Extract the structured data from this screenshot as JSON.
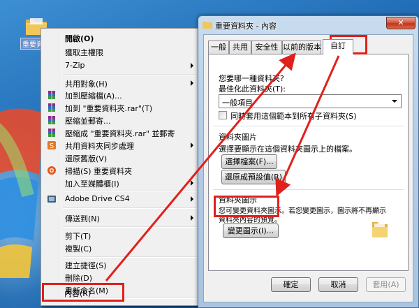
{
  "desktop": {
    "folder_label": "重要資料"
  },
  "context_menu": {
    "items": [
      {
        "label": "開啟(O)",
        "bold": true
      },
      {
        "label": "獲取主權限"
      },
      {
        "label": "7-Zip",
        "submenu": true
      },
      {
        "label": "共用對象(H)",
        "submenu": true
      },
      {
        "label": "加到壓縮檔(A)...",
        "icon": "winrar-icon"
      },
      {
        "label": "加到 \"重要資料夾.rar\"(T)",
        "icon": "winrar-icon"
      },
      {
        "label": "壓縮並郵寄...",
        "icon": "winrar-icon"
      },
      {
        "label": "壓縮成 \"重要資料夾.rar\" 並郵寄",
        "icon": "winrar-icon"
      },
      {
        "label": "共用資料夾同步處理",
        "submenu": true,
        "icon": "sync-icon"
      },
      {
        "label": "還原舊版(V)"
      },
      {
        "label": "掃描(S) 重要資料夾",
        "icon": "antivirus-icon"
      },
      {
        "label": "加入至媒體櫃(I)",
        "submenu": true
      },
      {
        "label": "Adobe Drive CS4",
        "submenu": true,
        "icon": "adobe-drive-icon"
      },
      {
        "label": "傳送到(N)",
        "submenu": true
      },
      {
        "label": "剪下(T)"
      },
      {
        "label": "複製(C)"
      },
      {
        "label": "建立捷徑(S)"
      },
      {
        "label": "刪除(D)"
      },
      {
        "label": "重新命名(M)"
      },
      {
        "label": "內容(R)"
      }
    ]
  },
  "dialog": {
    "title": "重要資料夾 - 內容",
    "close_label": "✕",
    "tabs": [
      "一般",
      "共用",
      "安全性",
      "以前的版本",
      "自訂"
    ],
    "active_tab": "自訂",
    "section1": {
      "heading": "您要哪一種資料夾?",
      "optimize_label": "最佳化此資料夾(T):",
      "select_value": "一般項目",
      "checkbox_label": "同時套用這個範本到所有子資料夾(S)"
    },
    "section2": {
      "heading": "資料夾圖片",
      "desc": "選擇要顯示在這個資料夾圖示上的檔案。",
      "choose_button": "選擇檔案(F)...",
      "restore_button": "還原成預設值(R)"
    },
    "section3": {
      "heading": "資料夾圖示",
      "desc_line1": "您可變更資料夾圖示。若您變更圖示，圖示將不再顯示",
      "desc_line2": "資料夾內容的預覽。",
      "change_button": "變更圖示(I)..."
    },
    "footer": {
      "ok": "確定",
      "cancel": "取消",
      "apply": "套用(A)"
    }
  },
  "colors": {
    "highlight": "#e0201b",
    "desktop": "#1f6fb8",
    "folder": "#f1c75a"
  }
}
